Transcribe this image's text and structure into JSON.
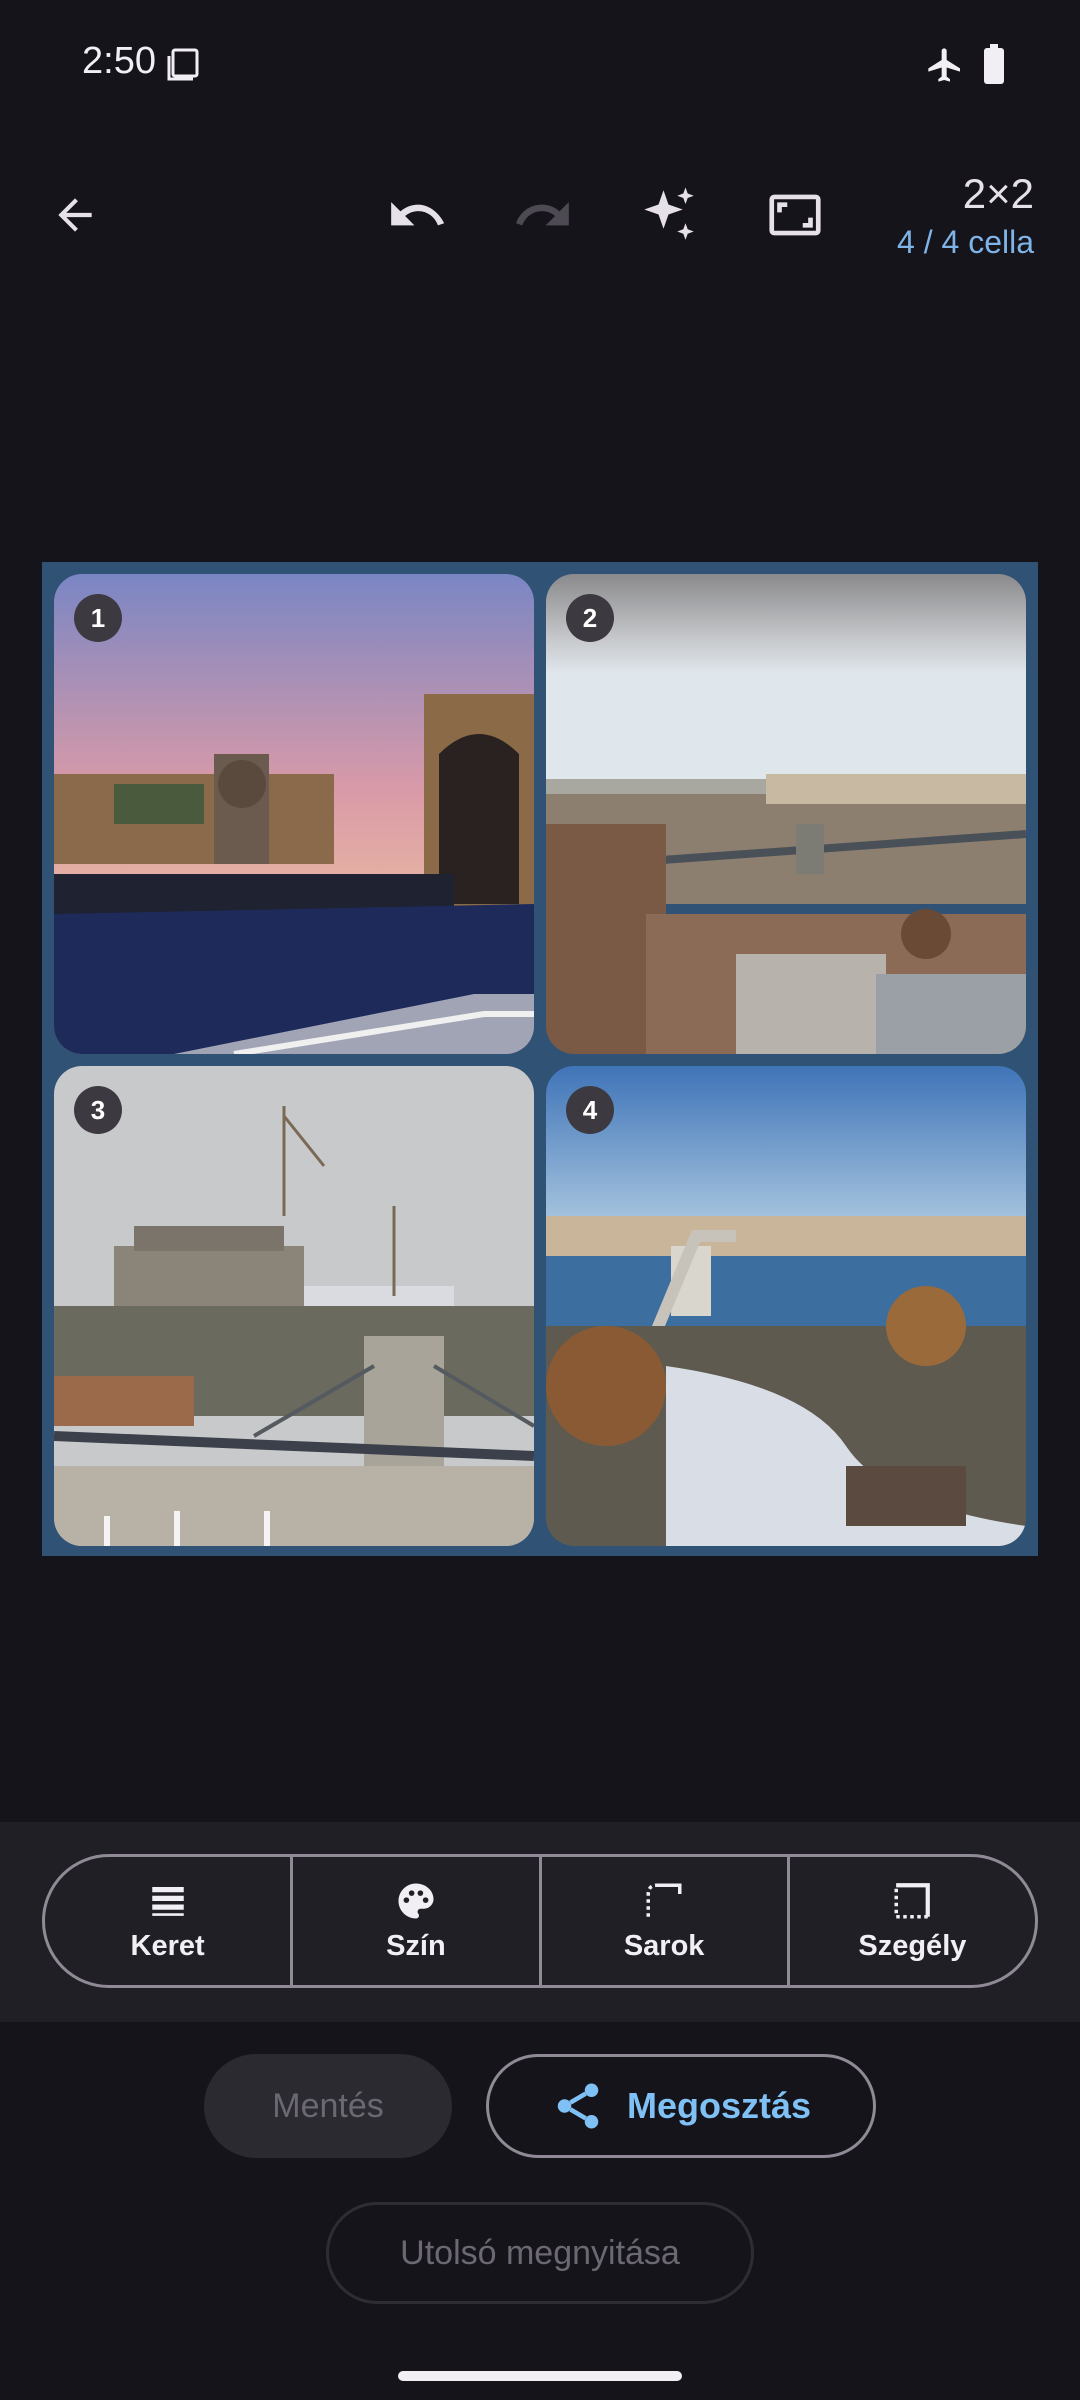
{
  "status_bar": {
    "time": "2:50",
    "icons": [
      "screenshot-icon",
      "airplane-mode-icon",
      "battery-icon"
    ]
  },
  "toolbar": {
    "back_icon": "arrow-left-icon",
    "undo_icon": "undo-icon",
    "redo_icon": "redo-icon",
    "magic_icon": "sparkle-icon",
    "fullscreen_icon": "fullscreen-icon",
    "grid_size": "2×2",
    "cell_count": "4 / 4 cella"
  },
  "collage": {
    "border_color": "#2f5275",
    "cells": [
      {
        "number": "1",
        "scene": "chain-bridge-lion-sunset"
      },
      {
        "number": "2",
        "scene": "danube-cloudy-panorama"
      },
      {
        "number": "3",
        "scene": "chain-bridge-foggy-castle"
      },
      {
        "number": "4",
        "scene": "danube-winter-aerial"
      }
    ]
  },
  "tools": [
    {
      "label": "Keret",
      "icon": "frame-lines-icon"
    },
    {
      "label": "Szín",
      "icon": "palette-icon"
    },
    {
      "label": "Sarok",
      "icon": "corner-icon"
    },
    {
      "label": "Szegély",
      "icon": "border-icon"
    }
  ],
  "actions": {
    "save": "Mentés",
    "share": "Megosztás",
    "share_icon": "share-icon",
    "open_last": "Utolsó megnyitása"
  },
  "colors": {
    "background": "#16141b",
    "accent": "#7fc0f5",
    "panel": "#211f26"
  }
}
